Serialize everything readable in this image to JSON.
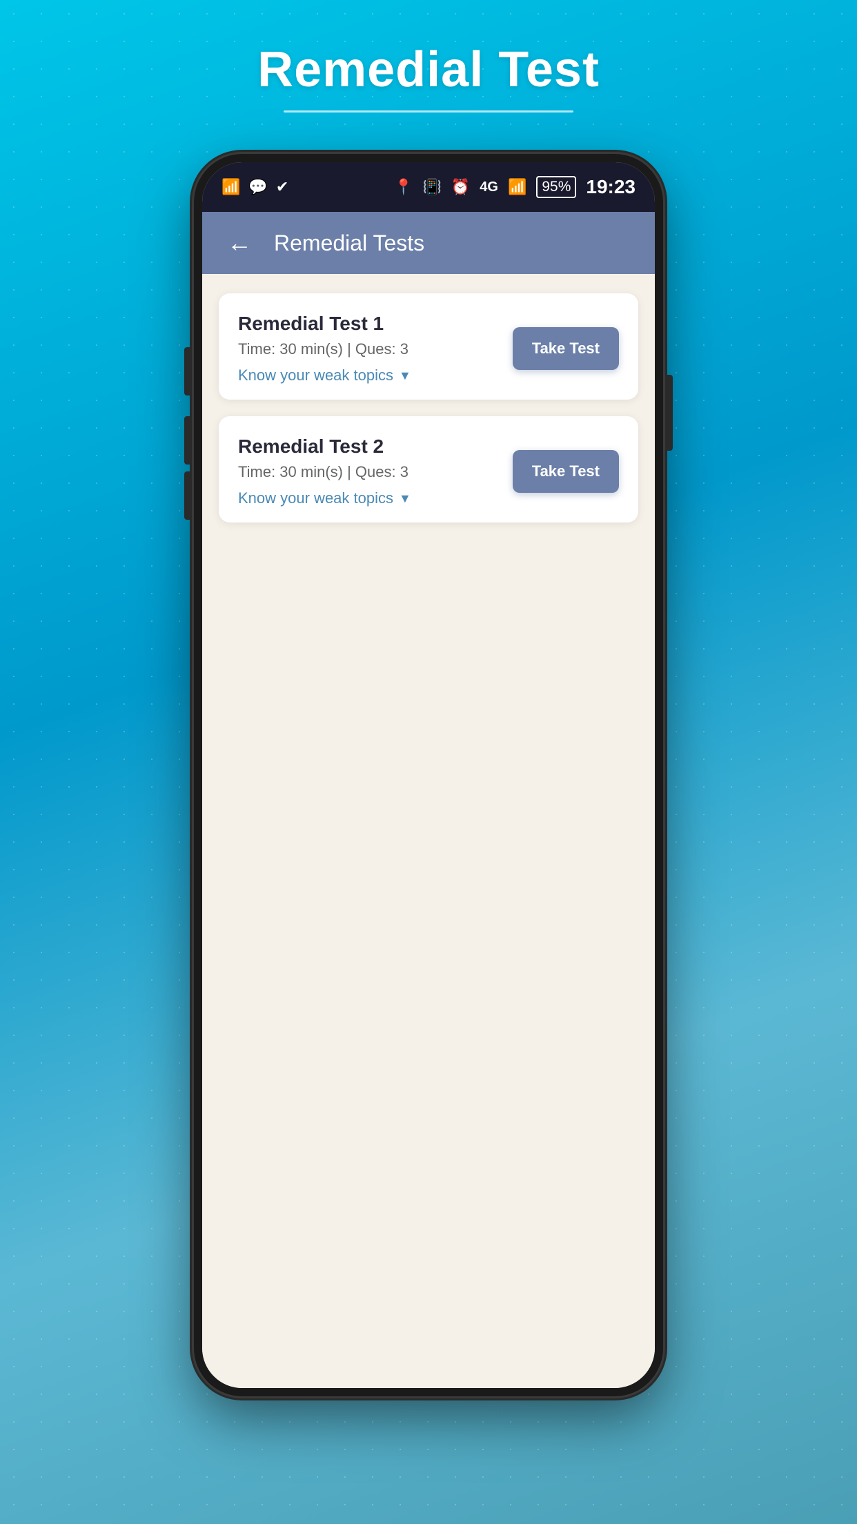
{
  "page": {
    "title": "Remedial Test",
    "title_underline": true
  },
  "status_bar": {
    "time": "19:23",
    "battery": "95%",
    "signal": "4G",
    "icons_left": [
      "wifi-icon",
      "message-icon",
      "check-icon"
    ],
    "icons_right": [
      "location-icon",
      "vibrate-icon",
      "alarm-icon",
      "signal-icon",
      "battery-icon"
    ]
  },
  "nav_bar": {
    "back_label": "←",
    "title": "Remedial Tests"
  },
  "tests": [
    {
      "id": 1,
      "name": "Remedial Test 1",
      "time": "Time: 30 min(s) | Ques: 3",
      "weak_topics_label": "Know your weak topics",
      "take_test_label": "Take Test"
    },
    {
      "id": 2,
      "name": "Remedial Test 2",
      "time": "Time: 30 min(s) | Ques: 3",
      "weak_topics_label": "Know your weak topics",
      "take_test_label": "Take Test"
    }
  ]
}
